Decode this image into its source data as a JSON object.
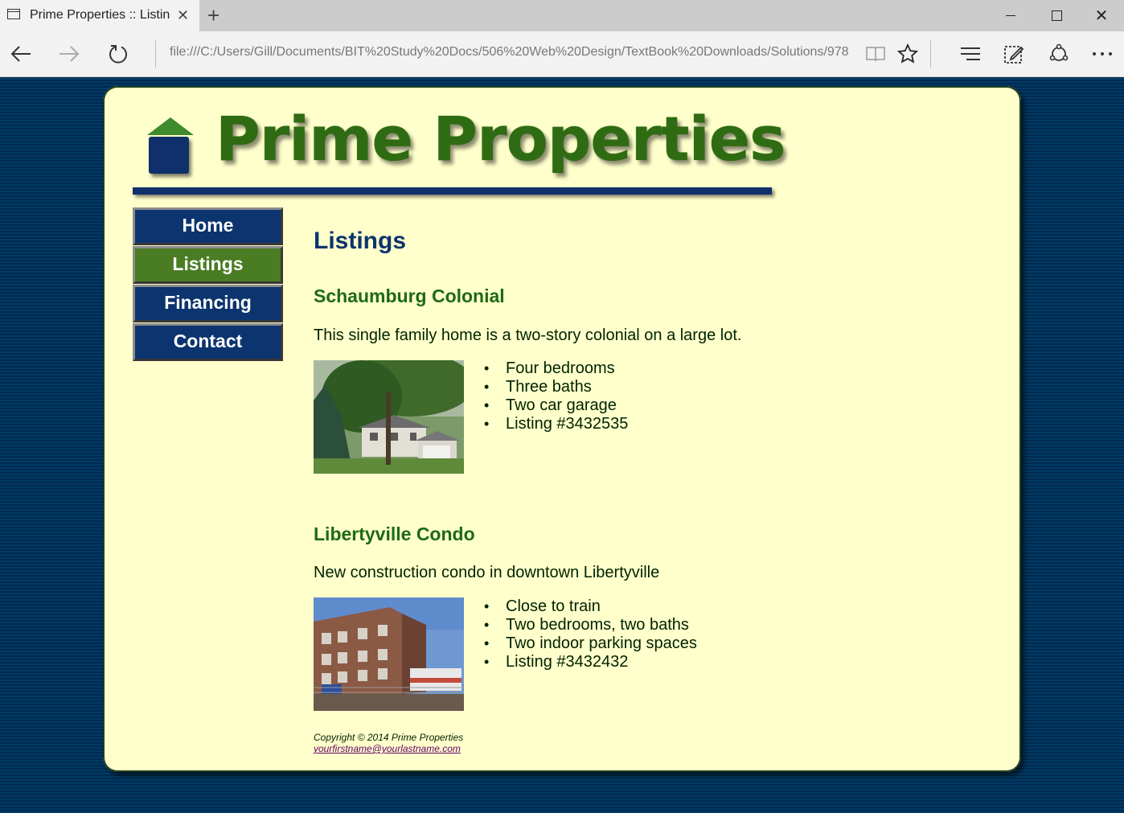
{
  "browser": {
    "tab_title": "Prime Properties :: Listin",
    "tab_close": "✕",
    "new_tab": "+",
    "address": "file:///C:/Users/Gill/Documents/BIT%20Study%20Docs/506%20Web%20Design/TextBook%20Downloads/Solutions/978",
    "icons": [
      "tab-page-icon",
      "back-arrow-icon",
      "forward-arrow-icon",
      "refresh-icon",
      "reading-view-icon",
      "favorite-star-icon",
      "hub-icon",
      "web-note-icon",
      "share-icon",
      "more-icon"
    ]
  },
  "site": {
    "logo_text": "Prime Properties",
    "nav": [
      {
        "label": "Home",
        "active": false
      },
      {
        "label": "Listings",
        "active": true
      },
      {
        "label": "Financing",
        "active": false
      },
      {
        "label": "Contact",
        "active": false
      }
    ],
    "colors": {
      "navy": "#0c346e",
      "green": "#4a7c24",
      "cream": "#ffffcc",
      "heading_green": "#1e6a14"
    }
  },
  "main": {
    "title": "Listings",
    "listings": [
      {
        "name": "Schaumburg Colonial",
        "description": "This single family home is a two-story colonial on a large lot.",
        "features": [
          "Four bedrooms",
          "Three baths",
          "Two car garage",
          "Listing #3432535"
        ]
      },
      {
        "name": "Libertyville Condo",
        "description": "New construction condo in downtown Libertyville",
        "features": [
          "Close to train",
          "Two bedrooms, two baths",
          "Two indoor parking spaces",
          "Listing #3432432"
        ]
      }
    ]
  },
  "footer": {
    "copyright": "Copyright © 2014 Prime Properties",
    "email": "yourfirstname@yourlastname.com"
  }
}
